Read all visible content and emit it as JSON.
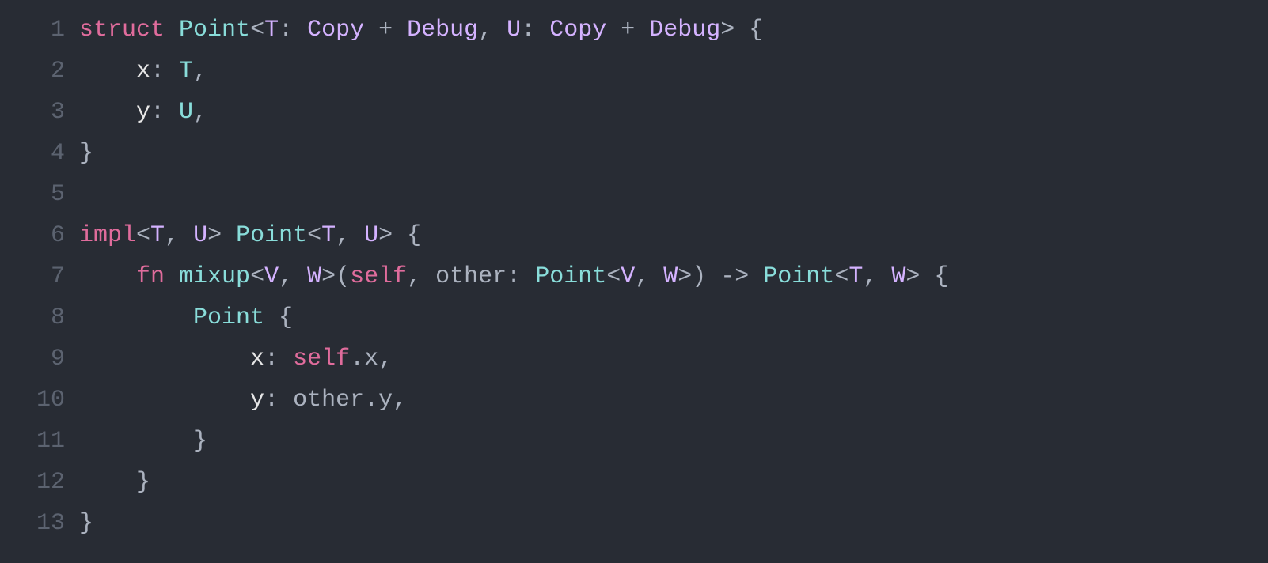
{
  "lineNumbers": [
    "1",
    "2",
    "3",
    "4",
    "5",
    "6",
    "7",
    "8",
    "9",
    "10",
    "11",
    "12",
    "13"
  ],
  "lines": [
    [
      {
        "t": "struct",
        "c": "tk-kw"
      },
      {
        "t": " ",
        "c": "tk-def"
      },
      {
        "t": "Point",
        "c": "tk-type"
      },
      {
        "t": "<",
        "c": "tk-def"
      },
      {
        "t": "T",
        "c": "tk-param"
      },
      {
        "t": ": ",
        "c": "tk-def"
      },
      {
        "t": "Copy",
        "c": "tk-param"
      },
      {
        "t": " + ",
        "c": "tk-def"
      },
      {
        "t": "Debug",
        "c": "tk-param"
      },
      {
        "t": ", ",
        "c": "tk-def"
      },
      {
        "t": "U",
        "c": "tk-param"
      },
      {
        "t": ": ",
        "c": "tk-def"
      },
      {
        "t": "Copy",
        "c": "tk-param"
      },
      {
        "t": " + ",
        "c": "tk-def"
      },
      {
        "t": "Debug",
        "c": "tk-param"
      },
      {
        "t": ">",
        "c": "tk-def"
      },
      {
        "t": " {",
        "c": "tk-def"
      }
    ],
    [
      {
        "t": "    ",
        "c": "tk-def"
      },
      {
        "t": "x",
        "c": "tk-field"
      },
      {
        "t": ": ",
        "c": "tk-def"
      },
      {
        "t": "T",
        "c": "tk-type"
      },
      {
        "t": ",",
        "c": "tk-def"
      }
    ],
    [
      {
        "t": "    ",
        "c": "tk-def"
      },
      {
        "t": "y",
        "c": "tk-field"
      },
      {
        "t": ": ",
        "c": "tk-def"
      },
      {
        "t": "U",
        "c": "tk-type"
      },
      {
        "t": ",",
        "c": "tk-def"
      }
    ],
    [
      {
        "t": "}",
        "c": "tk-def"
      }
    ],
    [
      {
        "t": "",
        "c": "tk-def"
      }
    ],
    [
      {
        "t": "impl",
        "c": "tk-kw"
      },
      {
        "t": "<",
        "c": "tk-def"
      },
      {
        "t": "T",
        "c": "tk-param"
      },
      {
        "t": ", ",
        "c": "tk-def"
      },
      {
        "t": "U",
        "c": "tk-param"
      },
      {
        "t": "> ",
        "c": "tk-def"
      },
      {
        "t": "Point",
        "c": "tk-type"
      },
      {
        "t": "<",
        "c": "tk-def"
      },
      {
        "t": "T",
        "c": "tk-param"
      },
      {
        "t": ", ",
        "c": "tk-def"
      },
      {
        "t": "U",
        "c": "tk-param"
      },
      {
        "t": "> {",
        "c": "tk-def"
      }
    ],
    [
      {
        "t": "    ",
        "c": "tk-def"
      },
      {
        "t": "fn",
        "c": "tk-kw"
      },
      {
        "t": " ",
        "c": "tk-def"
      },
      {
        "t": "mixup",
        "c": "tk-type"
      },
      {
        "t": "<",
        "c": "tk-def"
      },
      {
        "t": "V",
        "c": "tk-param"
      },
      {
        "t": ", ",
        "c": "tk-def"
      },
      {
        "t": "W",
        "c": "tk-param"
      },
      {
        "t": ">(",
        "c": "tk-def"
      },
      {
        "t": "self",
        "c": "tk-self"
      },
      {
        "t": ", other: ",
        "c": "tk-def"
      },
      {
        "t": "Point",
        "c": "tk-type"
      },
      {
        "t": "<",
        "c": "tk-def"
      },
      {
        "t": "V",
        "c": "tk-param"
      },
      {
        "t": ", ",
        "c": "tk-def"
      },
      {
        "t": "W",
        "c": "tk-param"
      },
      {
        "t": ">) -> ",
        "c": "tk-def"
      },
      {
        "t": "Point",
        "c": "tk-type"
      },
      {
        "t": "<",
        "c": "tk-def"
      },
      {
        "t": "T",
        "c": "tk-param"
      },
      {
        "t": ", ",
        "c": "tk-def"
      },
      {
        "t": "W",
        "c": "tk-param"
      },
      {
        "t": "> {",
        "c": "tk-def"
      }
    ],
    [
      {
        "t": "        ",
        "c": "tk-def"
      },
      {
        "t": "Point",
        "c": "tk-type"
      },
      {
        "t": " {",
        "c": "tk-def"
      }
    ],
    [
      {
        "t": "            ",
        "c": "tk-def"
      },
      {
        "t": "x",
        "c": "tk-field"
      },
      {
        "t": ": ",
        "c": "tk-def"
      },
      {
        "t": "self",
        "c": "tk-self"
      },
      {
        "t": ".x,",
        "c": "tk-def"
      }
    ],
    [
      {
        "t": "            ",
        "c": "tk-def"
      },
      {
        "t": "y",
        "c": "tk-field"
      },
      {
        "t": ": other.y,",
        "c": "tk-def"
      }
    ],
    [
      {
        "t": "        }",
        "c": "tk-def"
      }
    ],
    [
      {
        "t": "    }",
        "c": "tk-def"
      }
    ],
    [
      {
        "t": "}",
        "c": "tk-def"
      }
    ]
  ]
}
